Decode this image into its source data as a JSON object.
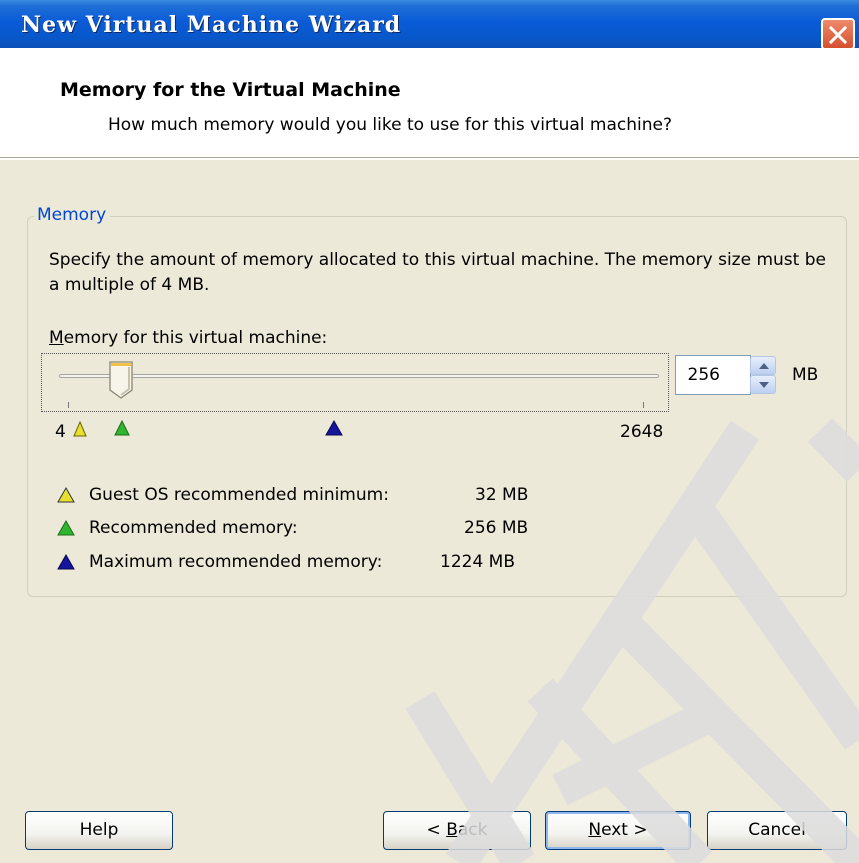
{
  "window": {
    "title": "New Virtual Machine Wizard"
  },
  "header": {
    "title": "Memory for the Virtual Machine",
    "subtitle": "How much memory would you like to use for this virtual machine?"
  },
  "memory_group": {
    "legend": "Memory",
    "description": "Specify the amount of memory allocated to this virtual machine. The memory size must be a multiple of 4 MB.",
    "slider_label_accel": "M",
    "slider_label_rest": "emory for this virtual machine:",
    "slider": {
      "min_label": "4",
      "max_label": "2648",
      "min": 4,
      "max": 2648,
      "value": 256
    },
    "spin_value": "256",
    "unit": "MB",
    "legend_rows": [
      {
        "label": "Guest OS recommended minimum:",
        "value": "32 MB",
        "color": "#e8e030"
      },
      {
        "label": "Recommended memory:",
        "value": "256 MB",
        "color": "#2fb52f"
      },
      {
        "label": "Maximum recommended memory:",
        "value": "1224 MB",
        "color": "#14149c"
      }
    ]
  },
  "buttons": {
    "help": "Help",
    "back_prefix": "< ",
    "back_accel": "B",
    "back_rest": "ack",
    "next_accel": "N",
    "next_rest": "ext >",
    "cancel": "Cancel"
  },
  "icons": {
    "close": "close-icon",
    "spin_up": "arrow-up-icon",
    "spin_down": "arrow-down-icon"
  },
  "colors": {
    "title_bar": "#0a5bd8",
    "legend_text": "#0046d5",
    "close_button": "#d4502e"
  }
}
